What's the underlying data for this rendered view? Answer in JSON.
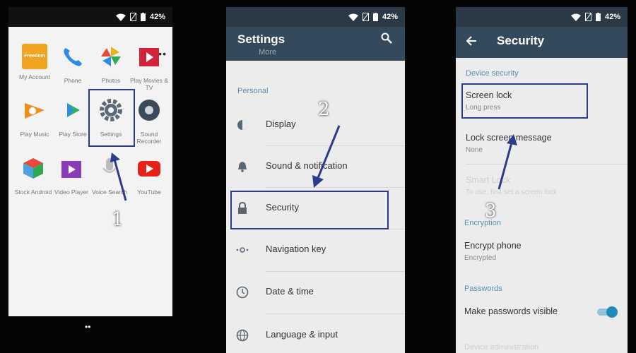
{
  "status": {
    "battery": "42%"
  },
  "home": {
    "overflow": "•••",
    "apps": [
      {
        "label": "My Account",
        "color": "#f0a422",
        "icon_text": "Freedom"
      },
      {
        "label": "Phone",
        "color": "#2d8ce6"
      },
      {
        "label": "Photos",
        "color": "#e9b21f"
      },
      {
        "label": "Play Movies & TV",
        "color": "#d2233b"
      },
      {
        "label": "Play Music",
        "color": "#f08c1a"
      },
      {
        "label": "Play Store",
        "color": "#2fb45c"
      },
      {
        "label": "Settings",
        "color": "#5b6a78"
      },
      {
        "label": "Sound Recorder",
        "color": "#3a4a5c"
      },
      {
        "label": "Stock Android",
        "color": "#4aa3e0"
      },
      {
        "label": "Video Player",
        "color": "#8a3bb8"
      },
      {
        "label": "Voice Search",
        "color": "#cfcfcf"
      },
      {
        "label": "YouTube",
        "color": "#e62117"
      }
    ],
    "page_dots": "••"
  },
  "settings": {
    "title": "Settings",
    "prev_item": "More",
    "section": "Personal",
    "items": [
      {
        "label": "Display"
      },
      {
        "label": "Sound & notification"
      },
      {
        "label": "Security"
      },
      {
        "label": "Navigation key"
      },
      {
        "label": "Date & time"
      },
      {
        "label": "Language & input"
      }
    ]
  },
  "security": {
    "title": "Security",
    "device_section": "Device security",
    "screen_lock": {
      "title": "Screen lock",
      "sub": "Long press"
    },
    "lock_message": {
      "title": "Lock screen message",
      "sub": "None"
    },
    "smart_lock": {
      "title": "Smart Lock",
      "sub": "To use, first set a screen lock"
    },
    "encryption_section": "Encryption",
    "encrypt_phone": {
      "title": "Encrypt phone",
      "sub": "Encrypted"
    },
    "passwords_section": "Passwords",
    "make_visible": {
      "title": "Make passwords visible",
      "enabled": true
    },
    "device_admin": {
      "title": "Device administration"
    }
  },
  "steps": [
    "1",
    "2",
    "3"
  ],
  "colors": {
    "highlight": "#2e3a8c",
    "toolbar": "#34495b",
    "accent": "#1f8ab8",
    "section": "#5a8fae"
  }
}
